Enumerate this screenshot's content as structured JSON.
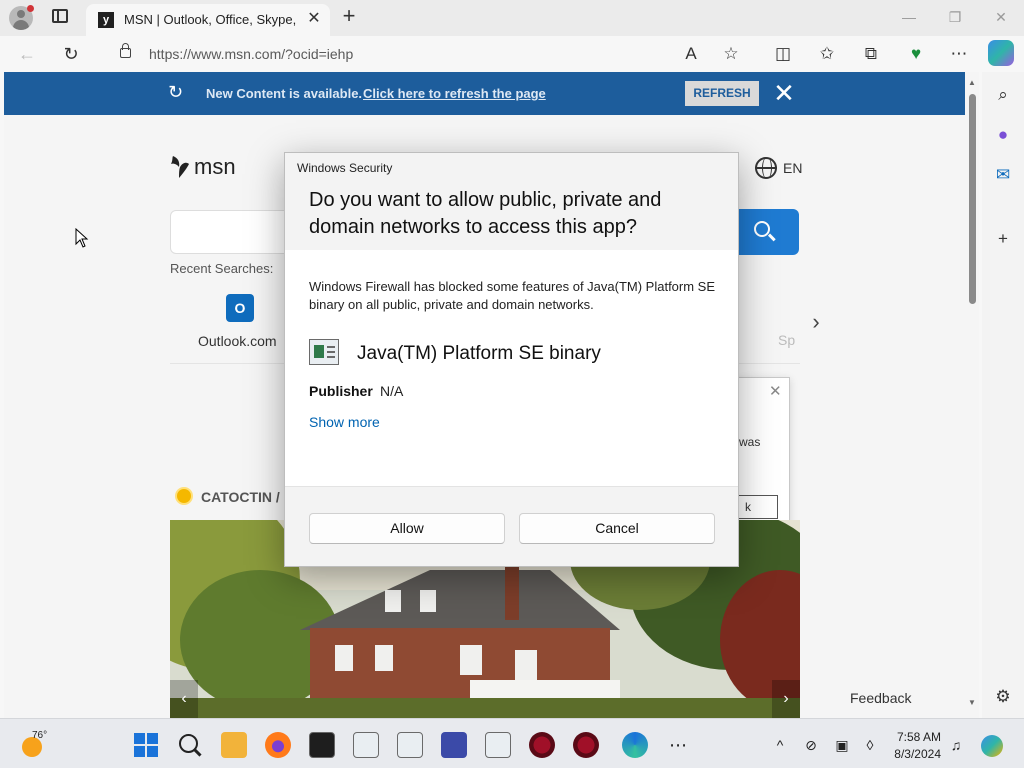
{
  "browser": {
    "tab_title": "MSN | Outlook, Office, Skype, Bi",
    "tab_favicon_letter": "y",
    "url": "https://www.msn.com/?ocid=iehp"
  },
  "page": {
    "notification": {
      "message": "New Content is available.",
      "link": "Click here to refresh the page",
      "button": "REFRESH"
    },
    "logo_text": "msn",
    "language": "EN",
    "recent_searches_label": "Recent Searches:",
    "quicklinks": [
      {
        "label": "Outlook.com",
        "icon": "outlook-icon"
      },
      {
        "label": "Sp",
        "icon": "faded-icon"
      }
    ],
    "weather_location": "CATOCTIN /",
    "background_popup": {
      "text": "was",
      "button": "k"
    },
    "feedback_label": "Feedback"
  },
  "dialog": {
    "caption": "Windows Security",
    "title": "Do you want to allow public, private and domain networks to access this app?",
    "description": "Windows Firewall has blocked some features of Java(TM) Platform SE binary on all public, private and domain networks.",
    "app_name": "Java(TM) Platform SE binary",
    "publisher_label": "Publisher",
    "publisher_value": "N/A",
    "show_more": "Show more",
    "allow_button": "Allow",
    "cancel_button": "Cancel"
  },
  "taskbar": {
    "weather_temp": "76°",
    "time": "7:58 AM",
    "date": "8/3/2024"
  },
  "colors": {
    "notification_bar": "#1d5d9c",
    "search_button": "#1f7bd2",
    "link": "#0063b1"
  }
}
